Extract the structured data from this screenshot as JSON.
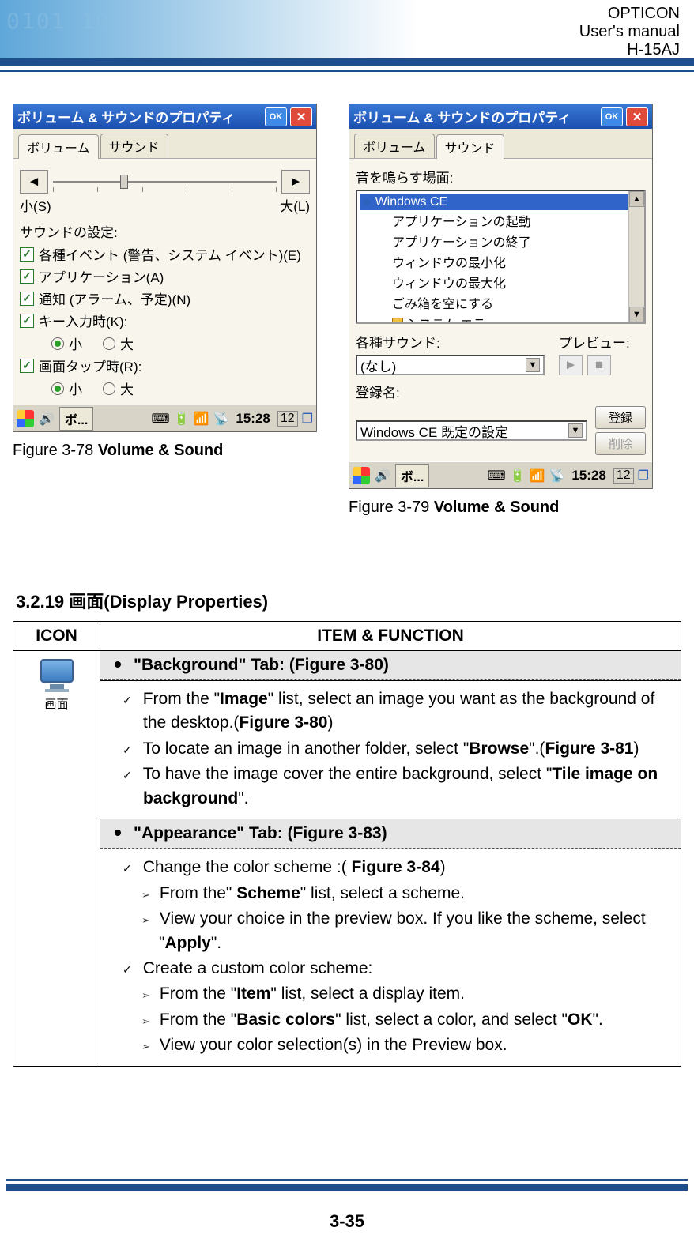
{
  "header": {
    "line1": "OPTICON",
    "line2": "User's manual",
    "line3": "H-15AJ"
  },
  "figures": {
    "left": {
      "title": "ボリューム & サウンドのプロパティ",
      "ok": "OK",
      "tabs": [
        "ボリューム",
        "サウンド"
      ],
      "small": "小(S)",
      "large": "大(L)",
      "sound_settings_label": "サウンドの設定:",
      "chk_events": "各種イベント (警告、システム イベント)(E)",
      "chk_apps": "アプリケーション(A)",
      "chk_notify": "通知 (アラーム、予定)(N)",
      "chk_keys": "キー入力時(K):",
      "r_small": "小",
      "r_large": "大",
      "chk_tap": "画面タップ時(R):",
      "task": "ボ...",
      "clock": "15:28",
      "cal": "12",
      "caption_prefix": "Figure 3-78 ",
      "caption_bold": "Volume & Sound"
    },
    "right": {
      "title": "ボリューム & サウンドのプロパティ",
      "ok": "OK",
      "tabs": [
        "ボリューム",
        "サウンド"
      ],
      "scene_label": "音を鳴らす場面:",
      "items": {
        "wince": "Windows CE",
        "app_start": "アプリケーションの起動",
        "app_end": "アプリケーションの終了",
        "win_min": "ウィンドウの最小化",
        "win_max": "ウィンドウの最大化",
        "trash": "ごみ箱を空にする",
        "syserr": "システム エラー"
      },
      "various_sound": "各種サウンド:",
      "preview": "プレビュー:",
      "none": "(なし)",
      "reg_label": "登録名:",
      "reg_btn": "登録",
      "del_btn": "削除",
      "reg_default": "Windows CE 既定の設定",
      "task": "ボ...",
      "clock": "15:28",
      "cal": "12",
      "caption_prefix": "Figure 3-79 ",
      "caption_bold": "Volume & Sound"
    }
  },
  "section": {
    "heading": "3.2.19  画面(Display Properties)",
    "th_icon": "ICON",
    "th_func": "ITEM & FUNCTION",
    "icon_label": "画面",
    "bg_tab": "\"Background\" Tab: (Figure 3-80)",
    "bg1a": "From the \"",
    "bg1b": "Image",
    "bg1c": "\" list, select an image you want as the background of the desktop.(",
    "bg1d": "Figure 3-80",
    "bg1e": ")",
    "bg2a": "To locate an image in another folder, select \"",
    "bg2b": "Browse",
    "bg2c": "\".(",
    "bg2d": "Figure 3-81",
    "bg2e": ")",
    "bg3a": "To have the image cover the entire background, select \"",
    "bg3b": "Tile image on background",
    "bg3c": "\".",
    "ap_tab": "\"Appearance\" Tab: (Figure 3-83)",
    "ap1a": "Change the color scheme :( ",
    "ap1b": "Figure 3-84",
    "ap1c": ")",
    "ap1_1a": "From the\" ",
    "ap1_1b": "Scheme",
    "ap1_1c": "\" list, select a scheme.",
    "ap1_2a": "View your choice in the preview box. If you like the scheme, select \"",
    "ap1_2b": "Apply",
    "ap1_2c": "\".",
    "ap2": "Create a custom color scheme:",
    "ap2_1a": "From the \"",
    "ap2_1b": "Item",
    "ap2_1c": "\" list, select a display item.",
    "ap2_2a": "From the \"",
    "ap2_2b": "Basic colors",
    "ap2_2c": "\" list, select a color, and select \"",
    "ap2_2d": "OK",
    "ap2_2e": "\".",
    "ap2_3": "View your color selection(s) in the Preview box."
  },
  "footer": {
    "pagenum": "3-35"
  }
}
